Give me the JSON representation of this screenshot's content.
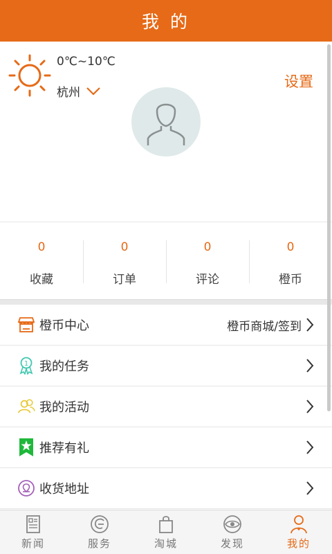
{
  "title": "我 的",
  "weather": {
    "temperature": "0℃~10℃",
    "city": "杭州"
  },
  "settings_label": "设置",
  "stats": [
    {
      "value": "0",
      "label": "收藏"
    },
    {
      "value": "0",
      "label": "订单"
    },
    {
      "value": "0",
      "label": "评论"
    },
    {
      "value": "0",
      "label": "橙币"
    }
  ],
  "menu": [
    {
      "label": "橙币中心",
      "extra": "橙币商城/签到",
      "icon": "shop-icon"
    },
    {
      "label": "我的任务",
      "icon": "medal-icon"
    },
    {
      "label": "我的活动",
      "icon": "people-icon"
    },
    {
      "label": "推荐有礼",
      "icon": "star-badge-icon"
    },
    {
      "label": "收货地址",
      "icon": "location-icon"
    }
  ],
  "tabs": [
    {
      "label": "新闻",
      "icon": "news-icon",
      "active": false
    },
    {
      "label": "服务",
      "icon": "service-icon",
      "active": false
    },
    {
      "label": "淘城",
      "icon": "shopping-bag-icon",
      "active": false
    },
    {
      "label": "发现",
      "icon": "discover-eye-icon",
      "active": false
    },
    {
      "label": "我的",
      "icon": "person-icon",
      "active": true
    }
  ],
  "colors": {
    "accent": "#e66a17"
  }
}
